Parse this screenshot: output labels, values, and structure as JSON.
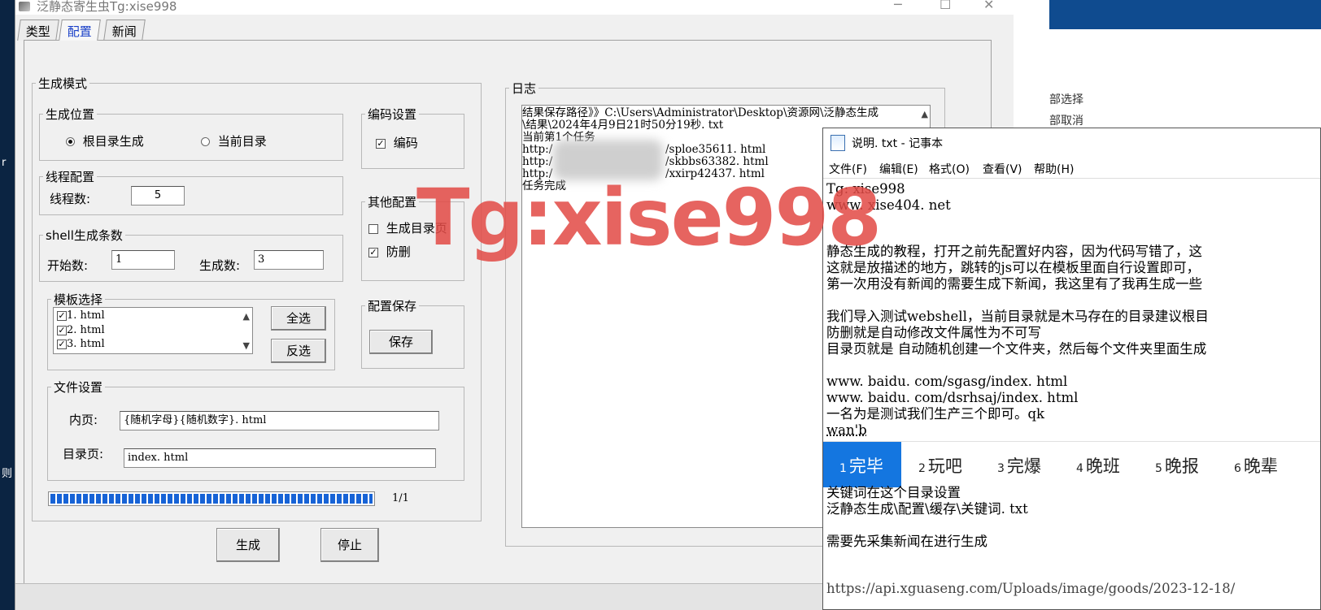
{
  "window": {
    "title": "泛静态寄生虫Tg:xise998"
  },
  "tabs": [
    "类型",
    "配置",
    "新闻"
  ],
  "gen_mode": {
    "legend": "生成模式",
    "location": {
      "legend": "生成位置",
      "opt1": "根目录生成",
      "opt2": "当前目录"
    },
    "thread": {
      "legend": "线程配置",
      "label": "线程数:",
      "value": "5"
    },
    "shell": {
      "legend": "shell生成条数",
      "start_label": "开始数:",
      "start_value": "1",
      "count_label": "生成数:",
      "count_value": "3"
    },
    "template": {
      "legend": "模板选择",
      "items": [
        "1. html",
        "2. html",
        "3. html"
      ],
      "select_all": "全选",
      "invert": "反选"
    },
    "encoding": {
      "legend": "编码设置",
      "label": "编码"
    },
    "other": {
      "legend": "其他配置",
      "dir_page": "生成目录页",
      "protect": "防删"
    },
    "save": {
      "legend": "配置保存",
      "button": "保存"
    },
    "file": {
      "legend": "文件设置",
      "inner_label": "内页:",
      "inner_value": "{随机字母}{随机数字}. html",
      "dir_label": "目录页:",
      "dir_value": "index. html"
    },
    "progress": {
      "text": "1/1",
      "fraction": 1.0
    }
  },
  "actions": {
    "generate": "生成",
    "stop": "停止"
  },
  "log": {
    "legend": "日志",
    "lines": [
      "结果保存路径》》C:\\Users\\Administrator\\Desktop\\资源网\\泛静态生成",
      "\\结果\\2024年4月9日21时50分19秒. txt",
      "当前第1个任务",
      "http:/",
      "/sploe35611. html",
      "http:/",
      "/skbbs63382. html",
      "http:/",
      "/xxirp42437. html",
      "任务完成"
    ]
  },
  "watermark": "Tg:xise998",
  "background": {
    "items": [
      "部选择",
      "部取消"
    ],
    "left_chars": [
      "r",
      "则"
    ]
  },
  "notepad": {
    "title": "说明. txt - 记事本",
    "menu": [
      "文件(F)",
      "编辑(E)",
      "格式(O)",
      "查看(V)",
      "帮助(H)"
    ],
    "lines": [
      "Tg: xise998",
      "www. xise404. net",
      "",
      "静态生成的教程，打开之前先配置好内容，因为代码写错了，这",
      "这就是放描述的地方，跳转的js可以在模板里面自行设置即可，",
      "第一次用没有新闻的需要生成下新闻，我这里有了我再生成一些",
      "",
      "我们导入测试webshell，当前目录就是木马存在的目录建议根目",
      "防删就是自动修改文件属性为不可写",
      "目录页就是 自动随机创建一个文件夹，然后每个文件夹里面生成",
      "",
      "www. baidu. com/sgasg/index. html",
      "www. baidu. com/dsrhsaj/index. html",
      "一名为是测试我们生产三个即可。qk",
      "wan'b"
    ],
    "ime": [
      {
        "num": "1",
        "text": "完毕"
      },
      {
        "num": "2",
        "text": "玩吧"
      },
      {
        "num": "3",
        "text": "完爆"
      },
      {
        "num": "4",
        "text": "晚班"
      },
      {
        "num": "5",
        "text": "晚报"
      },
      {
        "num": "6",
        "text": "晚辈"
      }
    ],
    "lines_after": [
      "关键词在这个目录设置",
      "泛静态生成\\配置\\缓存\\关键词. txt",
      "",
      "需要先采集新闻在进行生成",
      "",
      "",
      "https://api.xguaseng.com/Uploads/image/goods/2023-12-18/"
    ]
  }
}
